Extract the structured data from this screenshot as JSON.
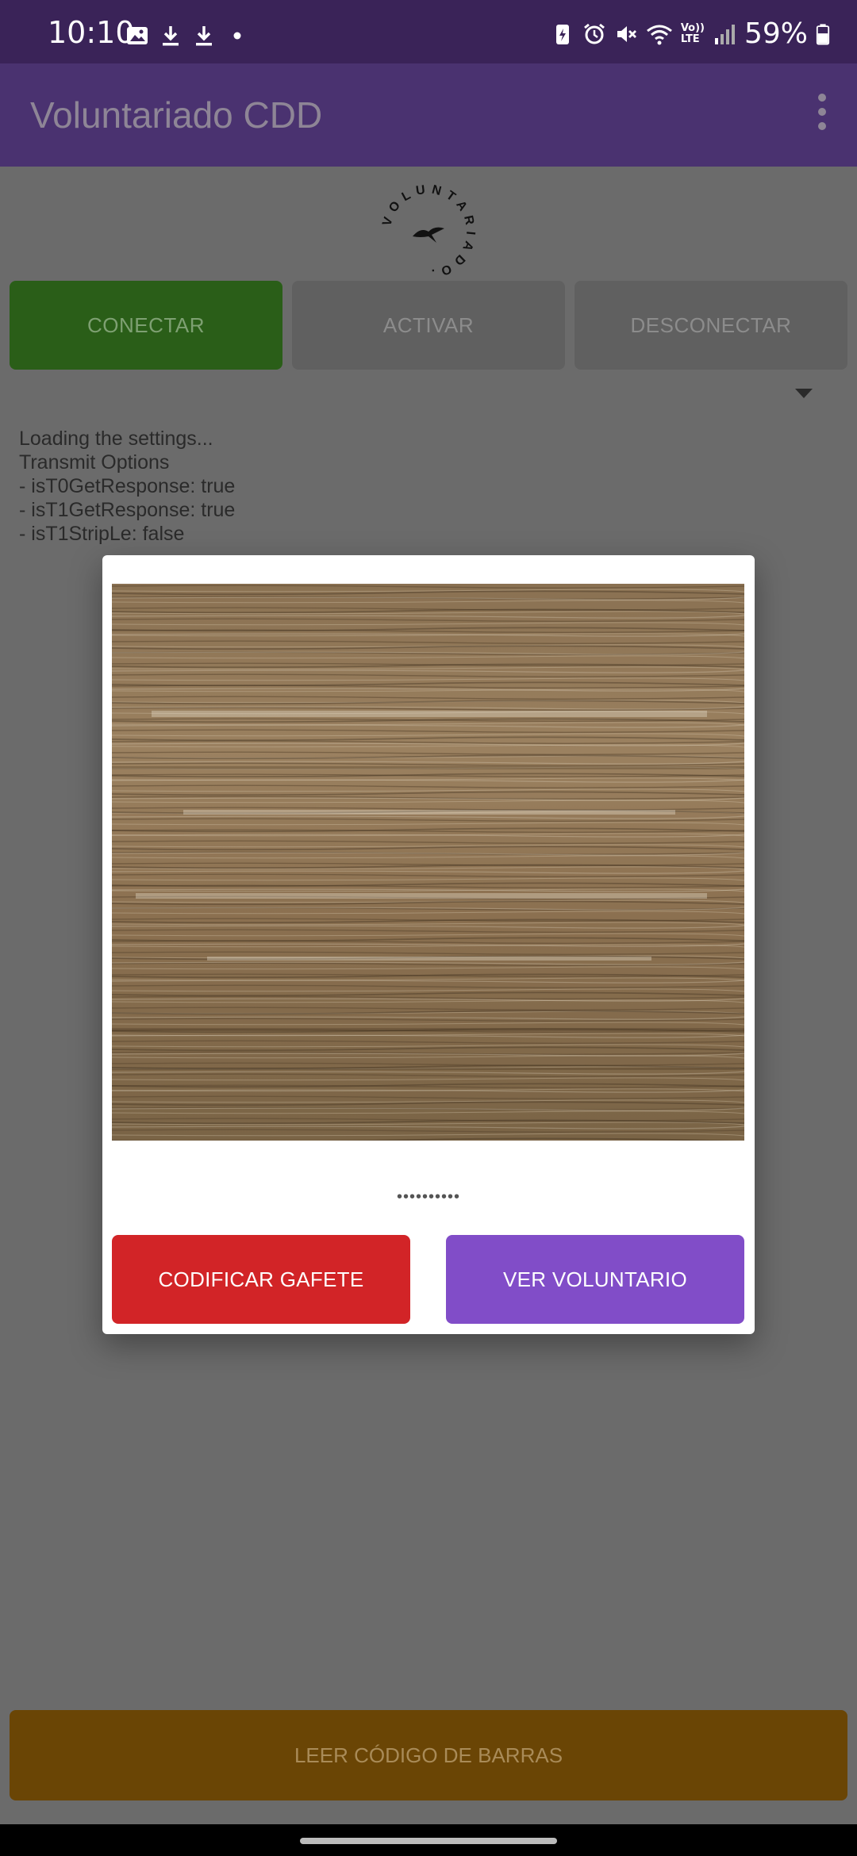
{
  "status_bar": {
    "time": "10:10",
    "battery": "59%",
    "left_icons": [
      "gallery-icon",
      "download-icon",
      "download-icon",
      "dot-icon"
    ],
    "right_icons": [
      "battery-saver-icon",
      "alarm-icon",
      "mute-icon",
      "wifi-icon",
      "volte-icon",
      "signal-icon",
      "battery-icon"
    ],
    "volte_label_top": "Vo))",
    "volte_label_bottom": "LTE"
  },
  "app_bar": {
    "title": "Voluntariado CDD",
    "menu_icon": "more-vert-icon"
  },
  "logo": {
    "text": "VOLUNTARIADO."
  },
  "buttons": {
    "connect": "CONECTAR",
    "activate": "ACTIVAR",
    "disconnect": "DESCONECTAR"
  },
  "log": {
    "lines": [
      "Loading the settings...",
      "Transmit Options",
      "- isT0GetResponse: true",
      "- isT1GetResponse: true",
      "- isT1StripLe: false"
    ]
  },
  "dialog": {
    "code": "••••••••••",
    "encode_button": "CODIFICAR GAFETE",
    "view_button": "VER VOLUNTARIO"
  },
  "bottom_button": "LEER CÓDIGO DE BARRAS",
  "colors": {
    "status_bar": "#3a2358",
    "app_bar": "#4a3270",
    "connect": "#2a5e18",
    "encode": "#d22427",
    "view": "#814dc8",
    "barcode": "#6a4505"
  }
}
